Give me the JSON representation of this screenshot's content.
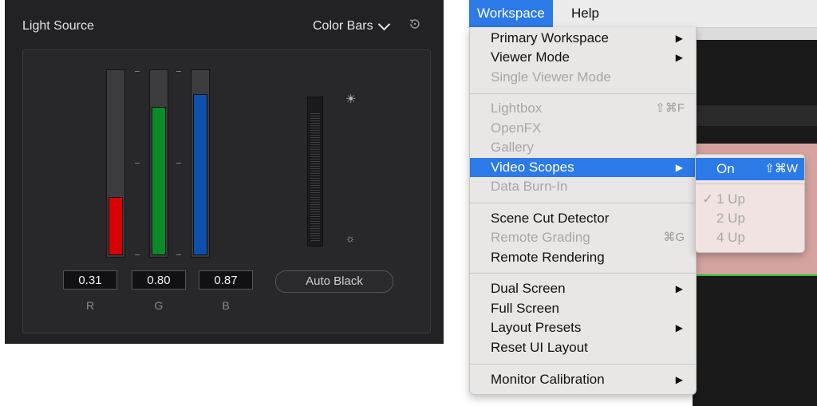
{
  "panel": {
    "title": "Light Source",
    "mode": "Color Bars",
    "channels": [
      {
        "label": "R",
        "value": "0.31",
        "level": 0.31,
        "color": "#d80000"
      },
      {
        "label": "G",
        "value": "0.80",
        "level": 0.8,
        "color": "#0a8a28"
      },
      {
        "label": "B",
        "value": "0.87",
        "level": 0.87,
        "color": "#0c4fad"
      }
    ],
    "auto_black_label": "Auto Black",
    "icons": {
      "reset": "reset-icon",
      "bright": "sun-icon"
    }
  },
  "menubar": {
    "items": [
      "Workspace",
      "Help"
    ]
  },
  "menu": {
    "items": [
      {
        "label": "Primary Workspace",
        "submenu": true,
        "enabled": true
      },
      {
        "label": "Viewer Mode",
        "submenu": true,
        "enabled": true
      },
      {
        "label": "Single Viewer Mode",
        "enabled": false
      },
      {
        "label": "Lightbox",
        "shortcut": "⇧⌘F",
        "enabled": false
      },
      {
        "label": "OpenFX",
        "enabled": false
      },
      {
        "label": "Gallery",
        "enabled": false
      },
      {
        "label": "Video Scopes",
        "submenu": true,
        "enabled": true,
        "highlighted": true
      },
      {
        "label": "Data Burn-In",
        "enabled": false
      },
      {
        "label": "Scene Cut Detector",
        "enabled": true
      },
      {
        "label": "Remote Grading",
        "shortcut": "⌘G",
        "enabled": false
      },
      {
        "label": "Remote Rendering",
        "enabled": true
      },
      {
        "label": "Dual Screen",
        "submenu": true,
        "enabled": true
      },
      {
        "label": "Full Screen",
        "enabled": true
      },
      {
        "label": "Layout Presets",
        "submenu": true,
        "enabled": true
      },
      {
        "label": "Reset UI Layout",
        "enabled": true
      },
      {
        "label": "Monitor Calibration",
        "submenu": true,
        "enabled": true
      }
    ]
  },
  "submenu": {
    "items": [
      {
        "label": "On",
        "shortcut": "⇧⌘W",
        "highlighted": true
      },
      {
        "label": "1 Up",
        "checked": true,
        "enabled": false
      },
      {
        "label": "2 Up",
        "enabled": false
      },
      {
        "label": "4 Up",
        "enabled": false
      }
    ],
    "check_glyph": "✓"
  },
  "colors": {
    "accent": "#2c7ae8",
    "panel_bg": "#222224"
  }
}
